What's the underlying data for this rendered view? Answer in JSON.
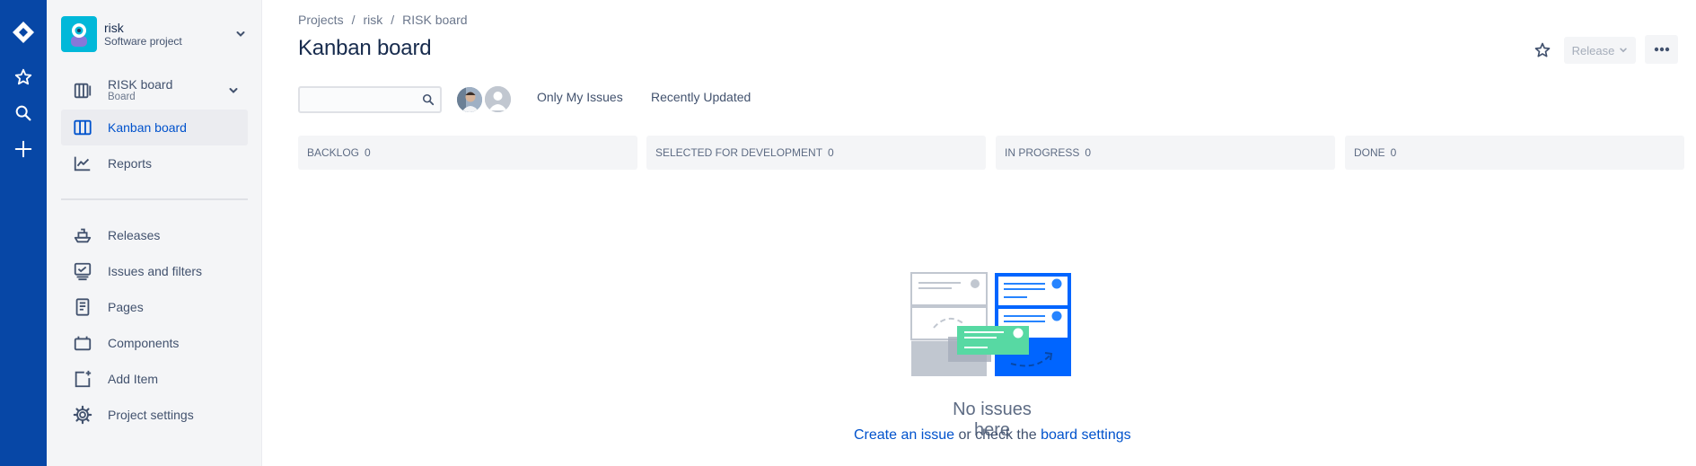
{
  "project": {
    "name": "risk",
    "type": "Software project",
    "avatar_color": "#00b8d9"
  },
  "sidebar": {
    "board": {
      "label": "RISK board",
      "sub": "Board"
    },
    "items": [
      {
        "label": "Kanban board",
        "icon": "kanban-icon",
        "active": true
      },
      {
        "label": "Reports",
        "icon": "reports-icon"
      },
      {
        "label": "Releases",
        "icon": "ship-icon"
      },
      {
        "label": "Issues and filters",
        "icon": "issues-icon"
      },
      {
        "label": "Pages",
        "icon": "page-icon"
      },
      {
        "label": "Components",
        "icon": "components-icon"
      },
      {
        "label": "Add Item",
        "icon": "add-item-icon"
      },
      {
        "label": "Project settings",
        "icon": "gear-icon"
      }
    ]
  },
  "breadcrumb": [
    "Projects",
    "risk",
    "RISK board"
  ],
  "page_title": "Kanban board",
  "actions": {
    "release_label": "Release"
  },
  "search": {
    "placeholder": "",
    "value": ""
  },
  "filters": [
    "Only My Issues",
    "Recently Updated"
  ],
  "columns": [
    {
      "name": "BACKLOG",
      "count": "0"
    },
    {
      "name": "SELECTED FOR DEVELOPMENT",
      "count": "0"
    },
    {
      "name": "IN PROGRESS",
      "count": "0"
    },
    {
      "name": "DONE",
      "count": "0"
    }
  ],
  "empty_state": {
    "title": "No issues here",
    "link1": "Create an issue",
    "middle": " or check the ",
    "link2": "board settings"
  },
  "colors": {
    "nav": "#0747a6",
    "accent": "#0052cc",
    "sidebar_bg": "#f4f5f7"
  }
}
